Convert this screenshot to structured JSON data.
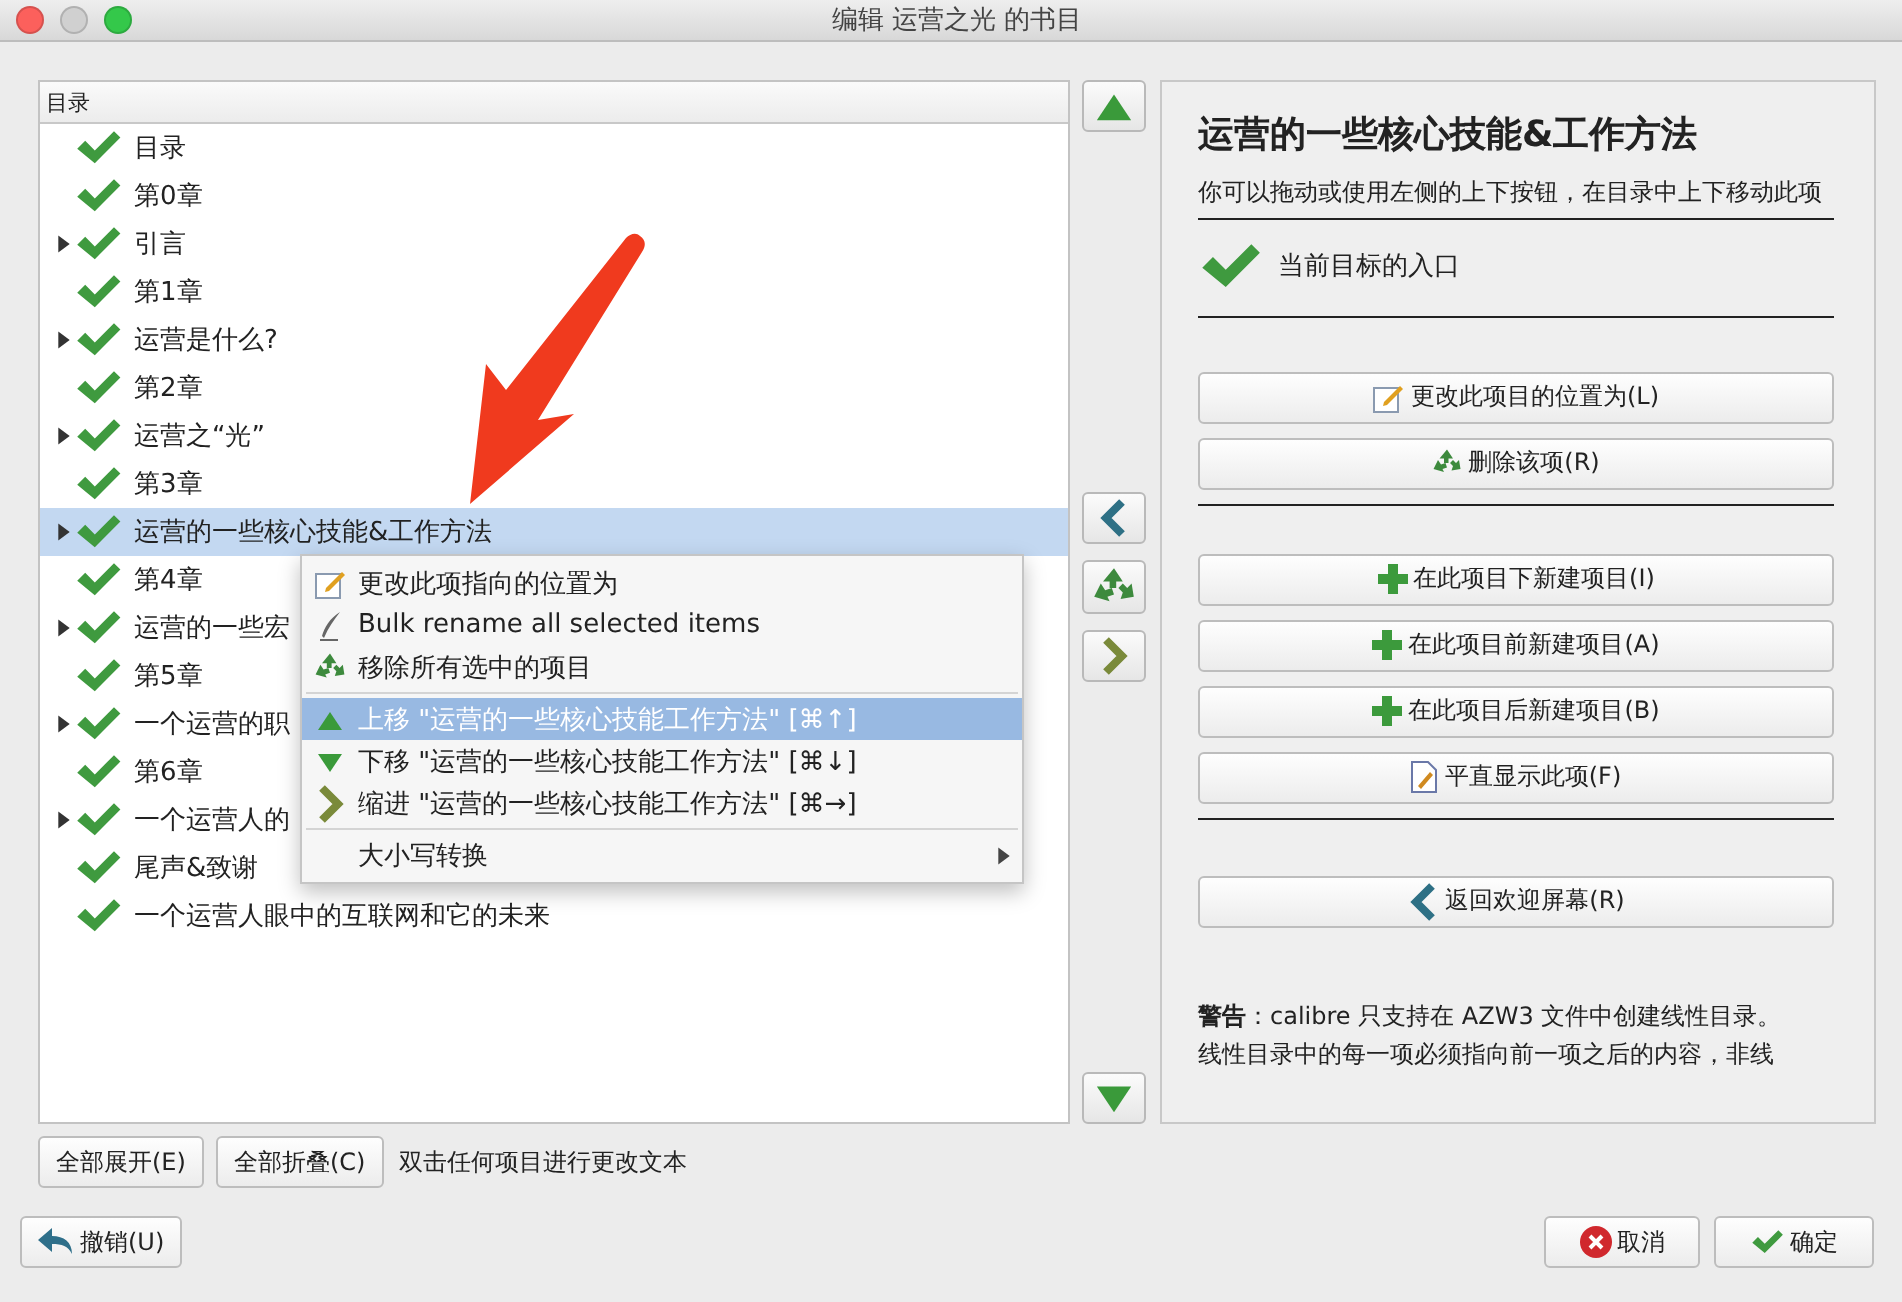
{
  "window": {
    "title": "编辑 运营之光 的书目"
  },
  "toc": {
    "header": "目录",
    "rows": [
      {
        "label": "目录",
        "kind": "leaf",
        "selected": false
      },
      {
        "label": "第0章",
        "kind": "leaf",
        "selected": false
      },
      {
        "label": "引言",
        "kind": "branch",
        "selected": false
      },
      {
        "label": "第1章",
        "kind": "leaf",
        "selected": false
      },
      {
        "label": "运营是什么?",
        "kind": "branch",
        "selected": false
      },
      {
        "label": "第2章",
        "kind": "leaf",
        "selected": false
      },
      {
        "label": "运营之“光”",
        "kind": "branch",
        "selected": false
      },
      {
        "label": "第3章",
        "kind": "leaf",
        "selected": false
      },
      {
        "label": "运营的一些核心技能&工作方法",
        "kind": "branch",
        "selected": true
      },
      {
        "label": "第4章",
        "kind": "leaf",
        "selected": false
      },
      {
        "label": "运营的一些宏",
        "kind": "branch",
        "selected": false
      },
      {
        "label": "第5章",
        "kind": "leaf",
        "selected": false
      },
      {
        "label": "一个运营的职",
        "kind": "branch",
        "selected": false
      },
      {
        "label": "第6章",
        "kind": "leaf",
        "selected": false
      },
      {
        "label": "一个运营人的",
        "kind": "branch",
        "selected": false
      },
      {
        "label": "尾声&致谢",
        "kind": "leaf",
        "selected": false
      },
      {
        "label": "一个运营人眼中的互联网和它的未来",
        "kind": "leaf",
        "selected": false
      }
    ]
  },
  "context_menu": {
    "items": [
      {
        "label": "更改此项指向的位置为",
        "kind": "edit",
        "selected": false
      },
      {
        "label": "Bulk rename all selected items",
        "kind": "pen",
        "selected": false
      },
      {
        "label": "移除所有选中的项目",
        "kind": "recycle",
        "selected": false
      },
      {
        "kind": "separator"
      },
      {
        "label": "上移 \"运营的一些核心技能工作方法\" [⌘↑]",
        "kind": "up",
        "selected": true
      },
      {
        "label": "下移 \"运营的一些核心技能工作方法\" [⌘↓]",
        "kind": "down",
        "selected": false
      },
      {
        "label": "缩进 \"运营的一些核心技能工作方法\" [⌘→]",
        "kind": "indent",
        "selected": false
      },
      {
        "kind": "separator"
      },
      {
        "label": "大小写转换",
        "kind": "submenu",
        "selected": false
      }
    ]
  },
  "side_buttons": [
    {
      "kind": "up"
    },
    {
      "kind": "left"
    },
    {
      "kind": "recycle"
    },
    {
      "kind": "right"
    },
    {
      "kind": "down"
    }
  ],
  "details": {
    "title": "运营的一些核心技能&工作方法",
    "description": "你可以拖动或使用左侧的上下按钮，在目录中上下移动此项",
    "status": "当前目标的入口",
    "button_groups": [
      [
        "更改此项目的位置为(L)",
        "删除该项(R)"
      ],
      [
        "在此项目下新建项目(I)",
        "在此项目前新建项目(A)",
        "在此项目后新建项目(B)",
        "平直显示此项(F)"
      ],
      [
        "返回欢迎屏幕(R)"
      ]
    ],
    "warning": "**警告**：calibre 只支持在 AZW3 文件中创建线性目录。",
    "warning_more": "线性目录中的每一项必须指向前一项之后的内容，非线"
  },
  "tree_buttons": [
    "全部展开(E)",
    "全部折叠(C)"
  ],
  "hint": "双击任何项目进行更改文本",
  "undo": "撤销(U)",
  "dialog_buttons": [
    {
      "label": "取消",
      "kind": "cancel"
    },
    {
      "label": "确定",
      "kind": "ok"
    }
  ]
}
